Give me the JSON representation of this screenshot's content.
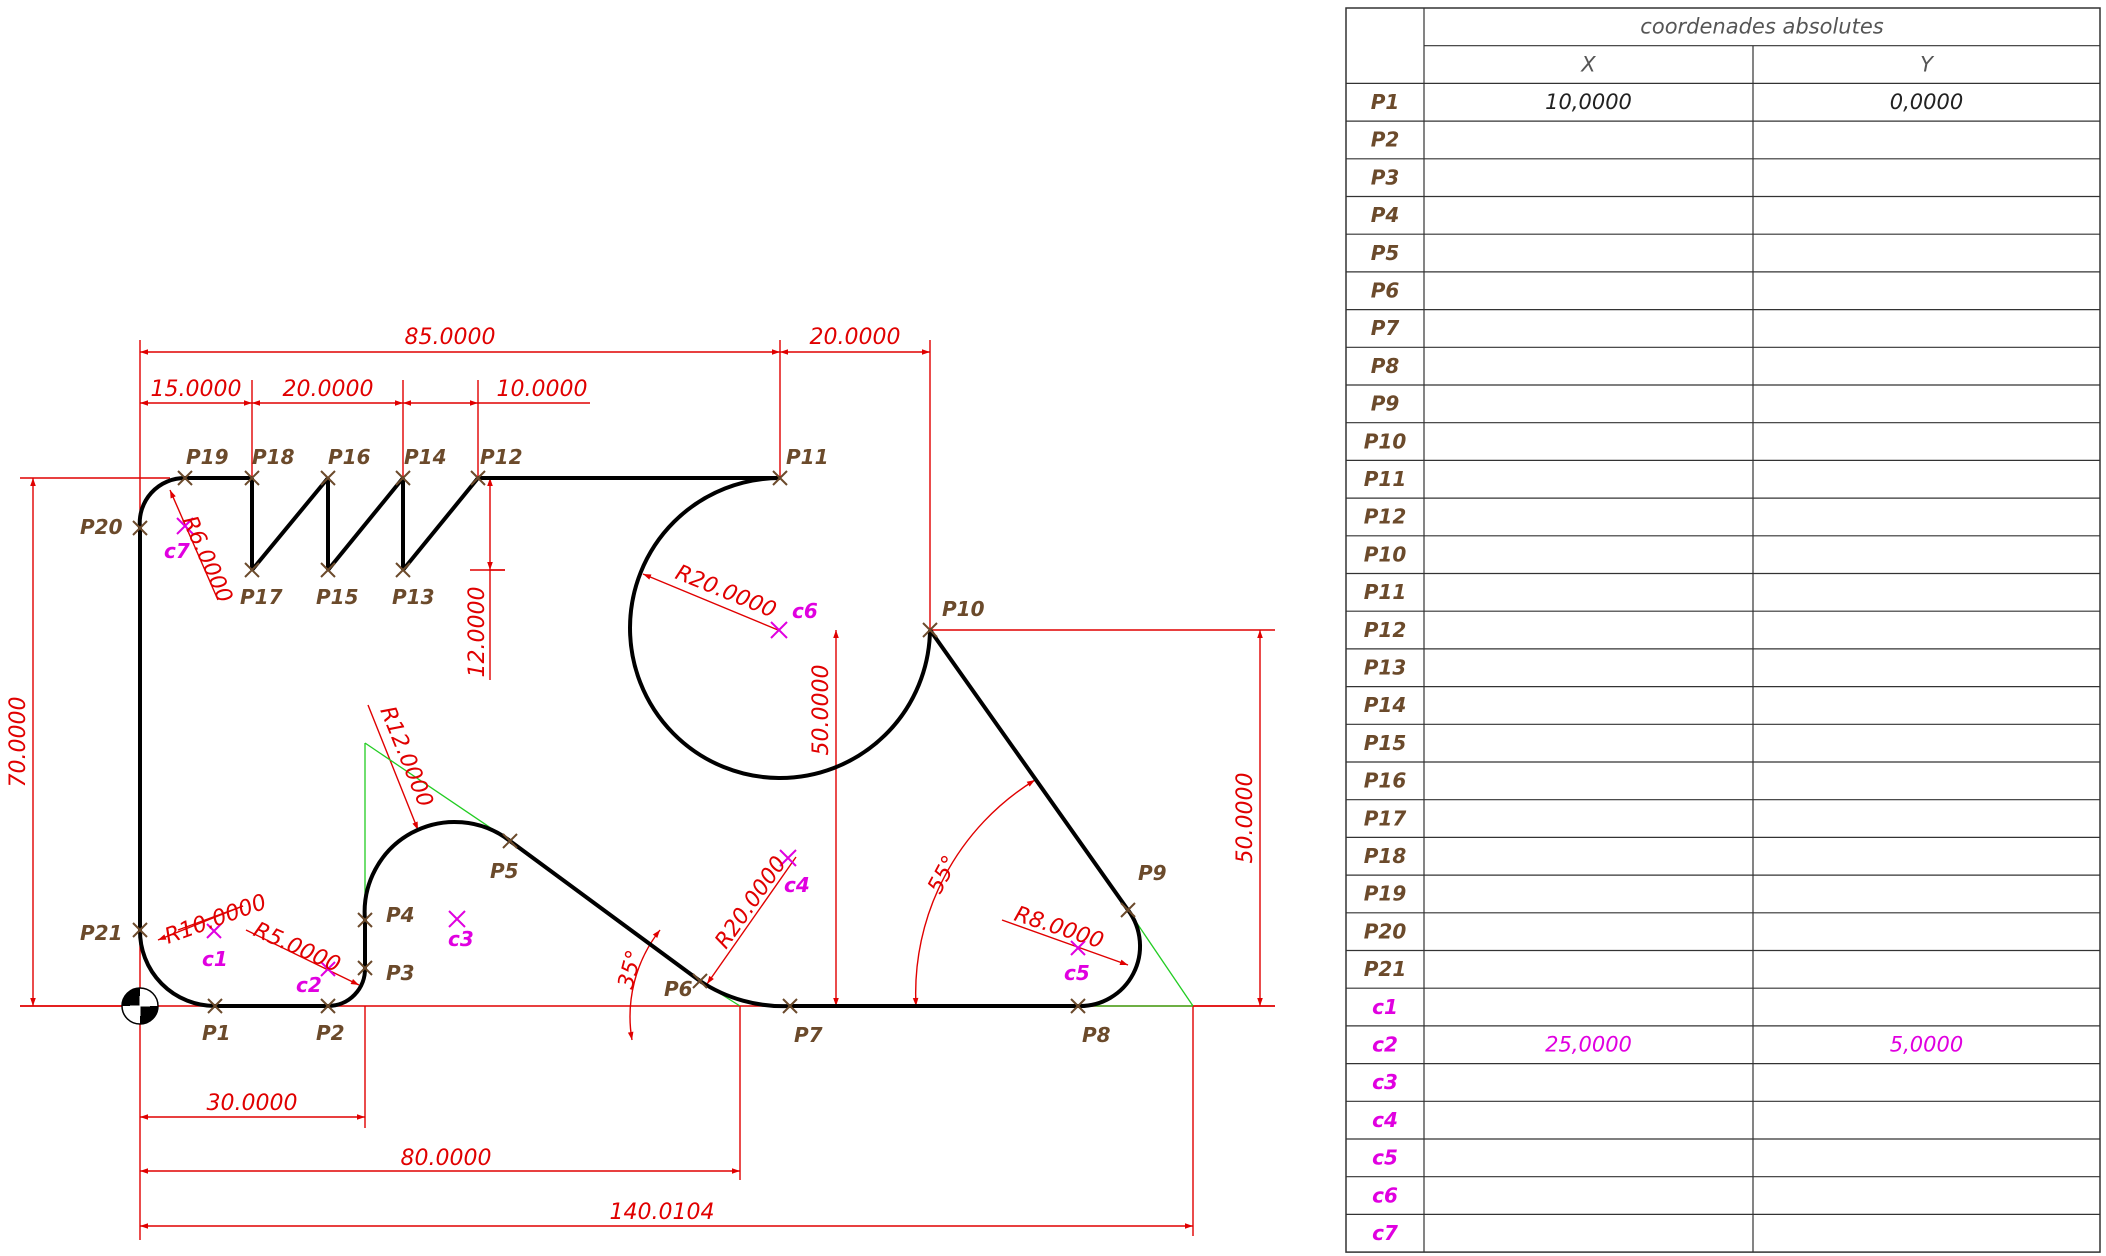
{
  "colors": {
    "outline": "#000000",
    "dimension": "#e00000",
    "point_label": "#6b4a2b",
    "center_label": "#e000e0",
    "construction": "#22cc22",
    "grid": "#333333"
  },
  "dimensions": {
    "d85": "85.0000",
    "d20_top": "20.0000",
    "d15": "15.0000",
    "d20_mid": "20.0000",
    "d10": "10.0000",
    "d70": "70.0000",
    "d12": "12.0000",
    "d50_mid": "50.0000",
    "d50_right": "50.0000",
    "d30": "30.0000",
    "d80": "80.0000",
    "d140": "140.0104",
    "r6": "R6.0000",
    "r20_top": "R20.0000",
    "r12": "R12.0000",
    "r10": "R10.0000",
    "r5": "R5.0000",
    "r20_bot": "R20.0000",
    "r8": "R8.0000",
    "a35": "35°",
    "a55": "55°"
  },
  "points": {
    "P1": "P1",
    "P2": "P2",
    "P3": "P3",
    "P4": "P4",
    "P5": "P5",
    "P6": "P6",
    "P7": "P7",
    "P8": "P8",
    "P9": "P9",
    "P10": "P10",
    "P11": "P11",
    "P12": "P12",
    "P13": "P13",
    "P14": "P14",
    "P15": "P15",
    "P16": "P16",
    "P17": "P17",
    "P18": "P18",
    "P19": "P19",
    "P20": "P20",
    "P21": "P21"
  },
  "centers": {
    "c1": "c1",
    "c2": "c2",
    "c3": "c3",
    "c4": "c4",
    "c5": "c5",
    "c6": "c6",
    "c7": "c7"
  },
  "table": {
    "title": "coordenades absolutes",
    "col_x": "X",
    "col_y": "Y",
    "rows": [
      {
        "label": "P1",
        "x": "10,0000",
        "y": "0,0000",
        "kind": "point"
      },
      {
        "label": "P2",
        "x": "",
        "y": "",
        "kind": "point"
      },
      {
        "label": "P3",
        "x": "",
        "y": "",
        "kind": "point"
      },
      {
        "label": "P4",
        "x": "",
        "y": "",
        "kind": "point"
      },
      {
        "label": "P5",
        "x": "",
        "y": "",
        "kind": "point"
      },
      {
        "label": "P6",
        "x": "",
        "y": "",
        "kind": "point"
      },
      {
        "label": "P7",
        "x": "",
        "y": "",
        "kind": "point"
      },
      {
        "label": "P8",
        "x": "",
        "y": "",
        "kind": "point"
      },
      {
        "label": "P9",
        "x": "",
        "y": "",
        "kind": "point"
      },
      {
        "label": "P10",
        "x": "",
        "y": "",
        "kind": "point"
      },
      {
        "label": "P11",
        "x": "",
        "y": "",
        "kind": "point"
      },
      {
        "label": "P12",
        "x": "",
        "y": "",
        "kind": "point"
      },
      {
        "label": "P10",
        "x": "",
        "y": "",
        "kind": "point"
      },
      {
        "label": "P11",
        "x": "",
        "y": "",
        "kind": "point"
      },
      {
        "label": "P12",
        "x": "",
        "y": "",
        "kind": "point"
      },
      {
        "label": "P13",
        "x": "",
        "y": "",
        "kind": "point"
      },
      {
        "label": "P14",
        "x": "",
        "y": "",
        "kind": "point"
      },
      {
        "label": "P15",
        "x": "",
        "y": "",
        "kind": "point"
      },
      {
        "label": "P16",
        "x": "",
        "y": "",
        "kind": "point"
      },
      {
        "label": "P17",
        "x": "",
        "y": "",
        "kind": "point"
      },
      {
        "label": "P18",
        "x": "",
        "y": "",
        "kind": "point"
      },
      {
        "label": "P19",
        "x": "",
        "y": "",
        "kind": "point"
      },
      {
        "label": "P20",
        "x": "",
        "y": "",
        "kind": "point"
      },
      {
        "label": "P21",
        "x": "",
        "y": "",
        "kind": "point"
      },
      {
        "label": "c1",
        "x": "",
        "y": "",
        "kind": "center"
      },
      {
        "label": "c2",
        "x": "25,0000",
        "y": "5,0000",
        "kind": "center"
      },
      {
        "label": "c3",
        "x": "",
        "y": "",
        "kind": "center"
      },
      {
        "label": "c4",
        "x": "",
        "y": "",
        "kind": "center"
      },
      {
        "label": "c5",
        "x": "",
        "y": "",
        "kind": "center"
      },
      {
        "label": "c6",
        "x": "",
        "y": "",
        "kind": "center"
      },
      {
        "label": "c7",
        "x": "",
        "y": "",
        "kind": "center"
      }
    ]
  }
}
